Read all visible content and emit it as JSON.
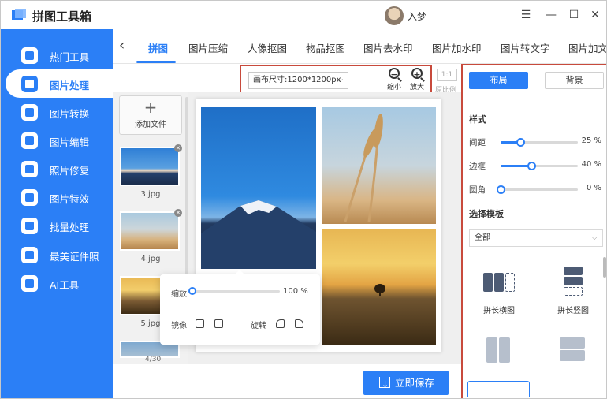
{
  "app": {
    "title": "拼图工具箱",
    "username": "入梦"
  },
  "window_controls": {
    "menu": "☰",
    "minimize": "—",
    "maximize": "☐",
    "close": "✕"
  },
  "sidebar": {
    "items": [
      {
        "label": "热门工具",
        "icon": "tools-icon"
      },
      {
        "label": "图片处理",
        "icon": "image-process-icon",
        "active": true
      },
      {
        "label": "图片转换",
        "icon": "image-convert-icon"
      },
      {
        "label": "图片编辑",
        "icon": "image-edit-icon"
      },
      {
        "label": "照片修复",
        "icon": "photo-repair-icon"
      },
      {
        "label": "图片特效",
        "icon": "image-effect-icon"
      },
      {
        "label": "批量处理",
        "icon": "batch-icon"
      },
      {
        "label": "最美证件照",
        "icon": "id-photo-icon"
      },
      {
        "label": "AI工具",
        "icon": "ai-icon"
      }
    ]
  },
  "tabs": [
    {
      "label": "拼图",
      "active": true
    },
    {
      "label": "图片压缩"
    },
    {
      "label": "人像抠图"
    },
    {
      "label": "物品抠图"
    },
    {
      "label": "图片去水印"
    },
    {
      "label": "图片加水印"
    },
    {
      "label": "图片转文字"
    },
    {
      "label": "图片加文"
    }
  ],
  "toolbar": {
    "canvas_size": "画布尺寸:1200*1200px",
    "zoom_out": "缩小",
    "zoom_in": "放大",
    "ratio_button": "1:1",
    "ratio_label": "原比例"
  },
  "files": {
    "add_label": "添加文件",
    "items": [
      {
        "name": "3.jpg"
      },
      {
        "name": "4.jpg"
      },
      {
        "name": "5.jpg"
      }
    ],
    "page_count": "4/30"
  },
  "popover": {
    "zoom_label": "缩放",
    "zoom_value": "100 %",
    "zoom_fraction": 0,
    "mirror_label": "镜像",
    "rotate_label": "旋转"
  },
  "save_button": "立即保存",
  "right_panel": {
    "seg_layout": "布局",
    "seg_background": "背景",
    "style_title": "样式",
    "sliders": [
      {
        "label": "间距",
        "value": 25,
        "display": "25 %"
      },
      {
        "label": "边框",
        "value": 40,
        "display": "40 %"
      },
      {
        "label": "圆角",
        "value": 0,
        "display": "0 %"
      }
    ],
    "template_title": "选择模板",
    "template_select": "全部",
    "templates": [
      {
        "label": "拼长横图"
      },
      {
        "label": "拼长竖图"
      }
    ]
  },
  "colors": {
    "accent": "#2b7ff6",
    "highlight_border": "#c84a3c"
  }
}
